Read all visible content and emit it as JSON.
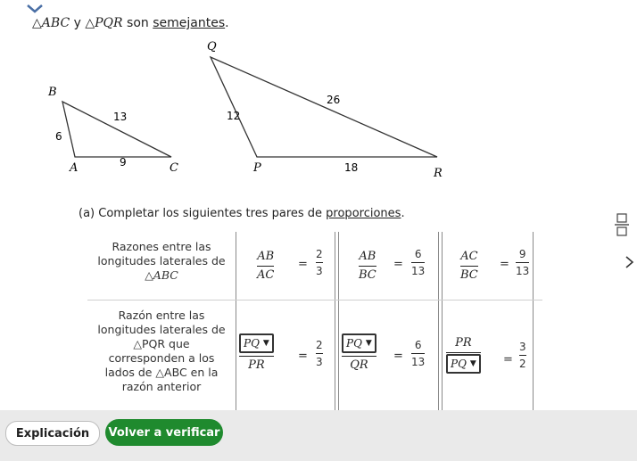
{
  "statement": {
    "tri1": "ABC",
    "connector": "y",
    "tri2": "PQR",
    "sentence_a": "son",
    "sentence_b": "semejantes",
    "sentence_end": "."
  },
  "figure": {
    "abc": {
      "A": "A",
      "B": "B",
      "C": "C",
      "AB": "6",
      "BC": "13",
      "AC": "9"
    },
    "pqr": {
      "P": "P",
      "Q": "Q",
      "R": "R",
      "PQ": "12",
      "QR": "26",
      "PR": "18"
    }
  },
  "part_a": {
    "prefix": "(a) Completar los siguientes tres pares de",
    "link": "proporciones",
    "suffix": "."
  },
  "table": {
    "row1_label": [
      "Razones entre las",
      "longitudes laterales de",
      "△ABC"
    ],
    "row2_label": [
      "Razón entre las",
      "longitudes laterales de",
      "△PQR que",
      "corresponden a los",
      "lados de △ABC en la",
      "razón anterior"
    ],
    "row1": [
      {
        "num": "AB",
        "den": "AC",
        "eq": "=",
        "vnum": "2",
        "vden": "3"
      },
      {
        "num": "AB",
        "den": "BC",
        "eq": "=",
        "vnum": "6",
        "vden": "13"
      },
      {
        "num": "AC",
        "den": "BC",
        "eq": "=",
        "vnum": "9",
        "vden": "13"
      }
    ],
    "row2": [
      {
        "num": "PQ",
        "den": "PR",
        "eq": "=",
        "vnum": "2",
        "vden": "3"
      },
      {
        "num": "PQ",
        "den": "QR",
        "eq": "=",
        "vnum": "6",
        "vden": "13"
      },
      {
        "num": "PR",
        "den": "PQ",
        "eq": "=",
        "vnum": "3",
        "vden": "2"
      }
    ]
  },
  "buttons": {
    "explain": "Explicación",
    "verify": "Volver a verificar"
  },
  "colors": {
    "verify_bg": "#1f8a2e",
    "bottom_bar": "#eaeaea"
  },
  "icons": {
    "collapse": "chevron-down-icon",
    "fraction_tool": "fraction-icon",
    "side": "chevron-right-icon"
  }
}
